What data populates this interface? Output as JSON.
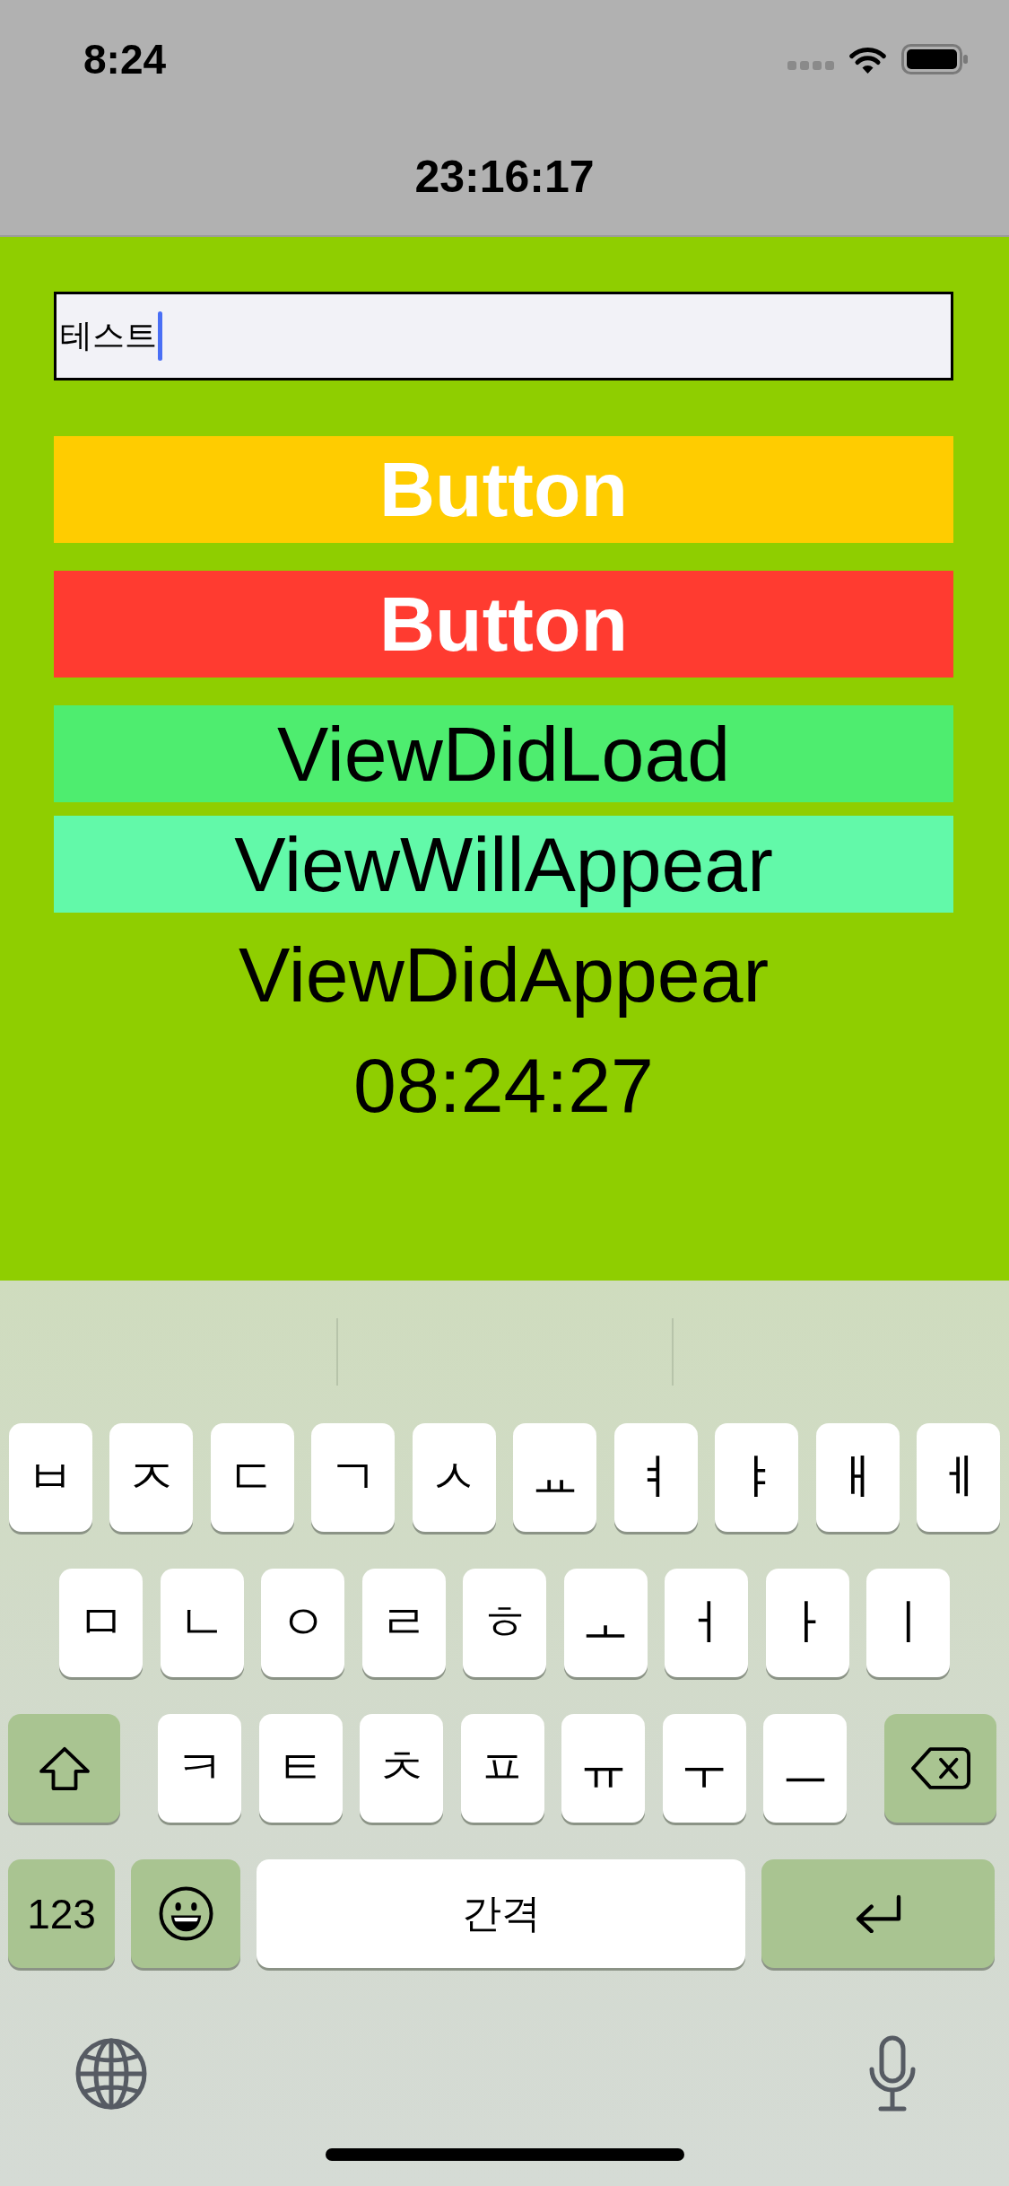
{
  "status_bar": {
    "time": "8:24"
  },
  "nav_bar": {
    "title": "23:16:17"
  },
  "text_field": {
    "value": "테스트",
    "focused": true
  },
  "buttons": [
    {
      "label": "Button",
      "color": "#ffcc00"
    },
    {
      "label": "Button",
      "color": "#ff3b30"
    }
  ],
  "labels": [
    {
      "text": "ViewDidLoad",
      "color": "#4eed6f"
    },
    {
      "text": "ViewWillAppear",
      "color": "#62f9a9"
    },
    {
      "text": "ViewDidAppear"
    },
    {
      "text": "08:24:27"
    }
  ],
  "keyboard": {
    "rows": [
      {
        "keys": [
          {
            "kind": "letter",
            "label": "ㅂ"
          },
          {
            "kind": "letter",
            "label": "ㅈ"
          },
          {
            "kind": "letter",
            "label": "ㄷ"
          },
          {
            "kind": "letter",
            "label": "ㄱ"
          },
          {
            "kind": "letter",
            "label": "ㅅ"
          },
          {
            "kind": "letter",
            "label": "ㅛ"
          },
          {
            "kind": "letter",
            "label": "ㅕ"
          },
          {
            "kind": "letter",
            "label": "ㅑ"
          },
          {
            "kind": "letter",
            "label": "ㅐ"
          },
          {
            "kind": "letter",
            "label": "ㅔ"
          }
        ]
      },
      {
        "keys": [
          {
            "kind": "letter",
            "label": "ㅁ"
          },
          {
            "kind": "letter",
            "label": "ㄴ"
          },
          {
            "kind": "letter",
            "label": "ㅇ"
          },
          {
            "kind": "letter",
            "label": "ㄹ"
          },
          {
            "kind": "letter",
            "label": "ㅎ"
          },
          {
            "kind": "letter",
            "label": "ㅗ"
          },
          {
            "kind": "letter",
            "label": "ㅓ"
          },
          {
            "kind": "letter",
            "label": "ㅏ"
          },
          {
            "kind": "letter",
            "label": "ㅣ"
          }
        ]
      },
      {
        "keys": [
          {
            "kind": "shift"
          },
          {
            "kind": "letter",
            "label": "ㅋ"
          },
          {
            "kind": "letter",
            "label": "ㅌ"
          },
          {
            "kind": "letter",
            "label": "ㅊ"
          },
          {
            "kind": "letter",
            "label": "ㅍ"
          },
          {
            "kind": "letter",
            "label": "ㅠ"
          },
          {
            "kind": "letter",
            "label": "ㅜ"
          },
          {
            "kind": "letter",
            "label": "ㅡ"
          },
          {
            "kind": "backspace"
          }
        ]
      },
      {
        "keys": [
          {
            "kind": "numbers",
            "label": "123"
          },
          {
            "kind": "emoji"
          },
          {
            "kind": "space",
            "label": "간격"
          },
          {
            "kind": "return"
          }
        ]
      }
    ]
  }
}
